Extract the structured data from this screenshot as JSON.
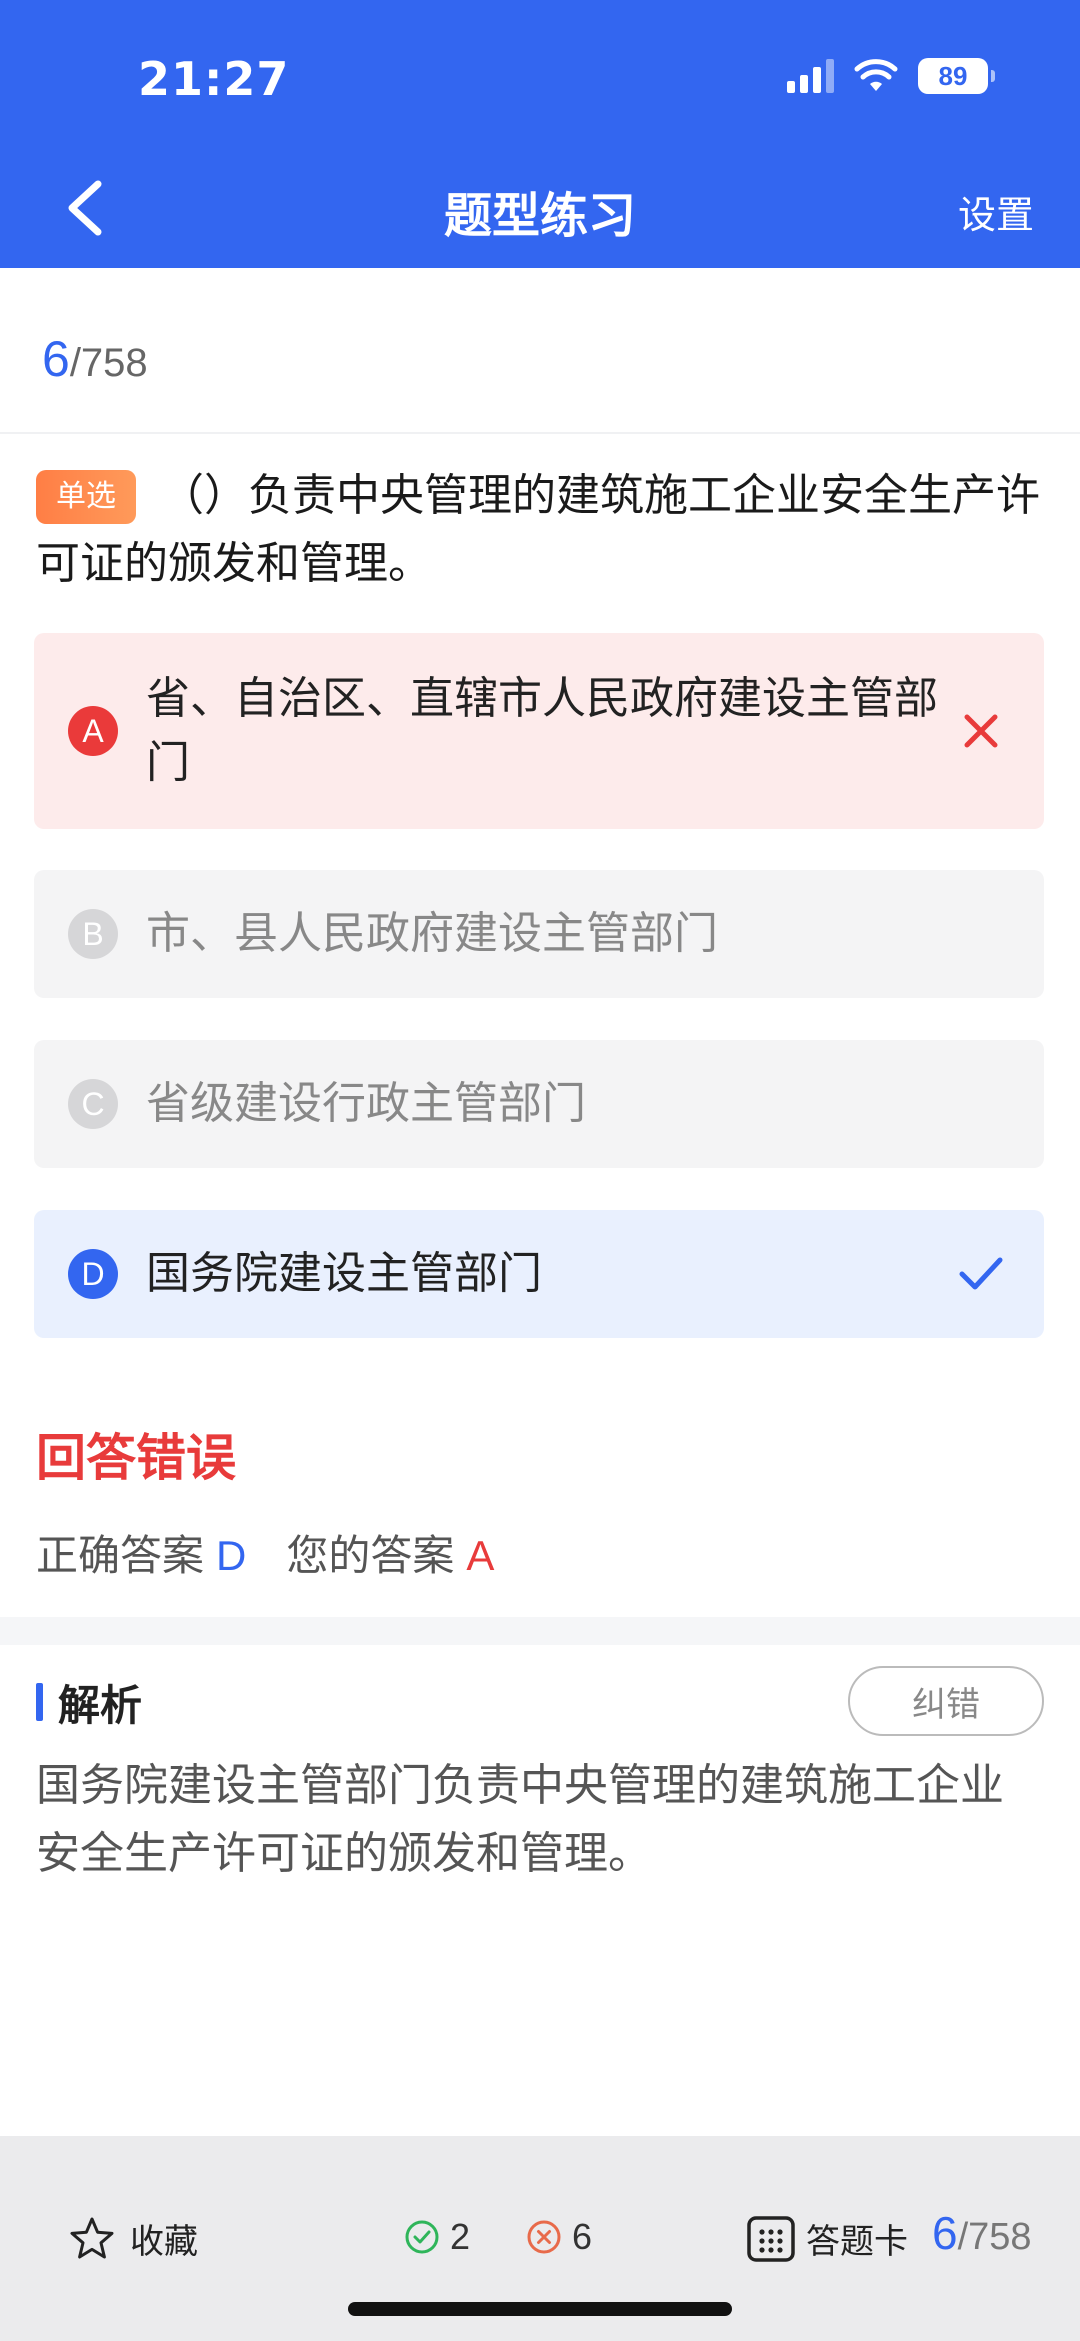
{
  "status_bar": {
    "time": "21:27",
    "battery": "89"
  },
  "nav": {
    "title": "题型练习",
    "settings_label": "设置"
  },
  "progress": {
    "current": "6",
    "total": "/758"
  },
  "question": {
    "type_tag": "单选",
    "text": "（）负责中央管理的建筑施工企业安全生产许可证的颁发和管理。"
  },
  "options": [
    {
      "letter": "A",
      "text": "省、自治区、直辖市人民政府建设主管部门",
      "state": "wrong"
    },
    {
      "letter": "B",
      "text": "市、县人民政府建设主管部门",
      "state": "normal"
    },
    {
      "letter": "C",
      "text": "省级建设行政主管部门",
      "state": "normal"
    },
    {
      "letter": "D",
      "text": "国务院建设主管部门",
      "state": "correct"
    }
  ],
  "result": {
    "title": "回答错误",
    "correct_label": "正确答案",
    "correct_value": "D",
    "yours_label": "您的答案",
    "yours_value": "A"
  },
  "analysis": {
    "title": "解析",
    "correction_label": "纠错",
    "text": "国务院建设主管部门负责中央管理的建筑施工企业安全生产许可证的颁发和管理。"
  },
  "bottom_bar": {
    "favorite_label": "收藏",
    "right_count": "2",
    "wrong_count": "6",
    "answer_card_label": "答题卡",
    "progress_current": "6",
    "progress_total": "/758"
  },
  "colors": {
    "primary": "#3366f0",
    "error": "#e83b3b",
    "success": "#2fb55a",
    "tag": "#ff7e45"
  }
}
